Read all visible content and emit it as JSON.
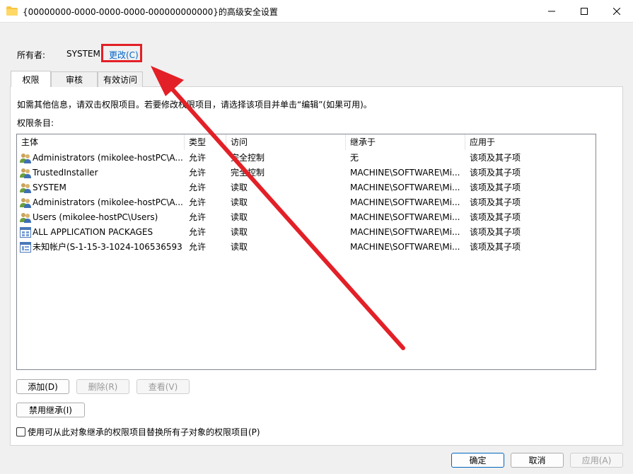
{
  "window": {
    "title": "{00000000-0000-0000-0000-000000000000}的高级安全设置"
  },
  "owner": {
    "label": "所有者:",
    "value": "SYSTEM",
    "change_link": "更改(C)"
  },
  "tabs": [
    {
      "label": "权限"
    },
    {
      "label": "审核"
    },
    {
      "label": "有效访问"
    }
  ],
  "info_text": "如需其他信息，请双击权限项目。若要修改权限项目，请选择该项目并单击“编辑”(如果可用)。",
  "entries_label": "权限条目:",
  "columns": {
    "principal": "主体",
    "type": "类型",
    "access": "访问",
    "inherited": "继承于",
    "applies": "应用于"
  },
  "rows": [
    {
      "principal": "Administrators (mikolee-hostPC\\A...",
      "type": "允许",
      "access": "完全控制",
      "inherited": "无",
      "applies": "该项及其子项",
      "icon": "group-icon"
    },
    {
      "principal": "TrustedInstaller",
      "type": "允许",
      "access": "完全控制",
      "inherited": "MACHINE\\SOFTWARE\\Mi...",
      "applies": "该项及其子项",
      "icon": "group-icon"
    },
    {
      "principal": "SYSTEM",
      "type": "允许",
      "access": "读取",
      "inherited": "MACHINE\\SOFTWARE\\Mi...",
      "applies": "该项及其子项",
      "icon": "group-icon"
    },
    {
      "principal": "Administrators (mikolee-hostPC\\A...",
      "type": "允许",
      "access": "读取",
      "inherited": "MACHINE\\SOFTWARE\\Mi...",
      "applies": "该项及其子项",
      "icon": "group-icon"
    },
    {
      "principal": "Users (mikolee-hostPC\\Users)",
      "type": "允许",
      "access": "读取",
      "inherited": "MACHINE\\SOFTWARE\\Mi...",
      "applies": "该项及其子项",
      "icon": "group-icon"
    },
    {
      "principal": "ALL APPLICATION PACKAGES",
      "type": "允许",
      "access": "读取",
      "inherited": "MACHINE\\SOFTWARE\\Mi...",
      "applies": "该项及其子项",
      "icon": "app-packages-icon"
    },
    {
      "principal": "未知帐户(S-1-15-3-1024-106536593...",
      "type": "允许",
      "access": "读取",
      "inherited": "MACHINE\\SOFTWARE\\Mi...",
      "applies": "该项及其子项",
      "icon": "unknown-account-icon"
    }
  ],
  "buttons": {
    "add": "添加(D)",
    "remove": "删除(R)",
    "view": "查看(V)",
    "disable_inheritance": "禁用继承(I)",
    "ok": "确定",
    "cancel": "取消",
    "apply": "应用(A)"
  },
  "replace_checkbox": {
    "label": "使用可从此对象继承的权限项目替换所有子对象的权限项目(P)",
    "checked": false
  },
  "colors": {
    "annotation_red": "#e32027",
    "link_blue": "#0066cc"
  }
}
